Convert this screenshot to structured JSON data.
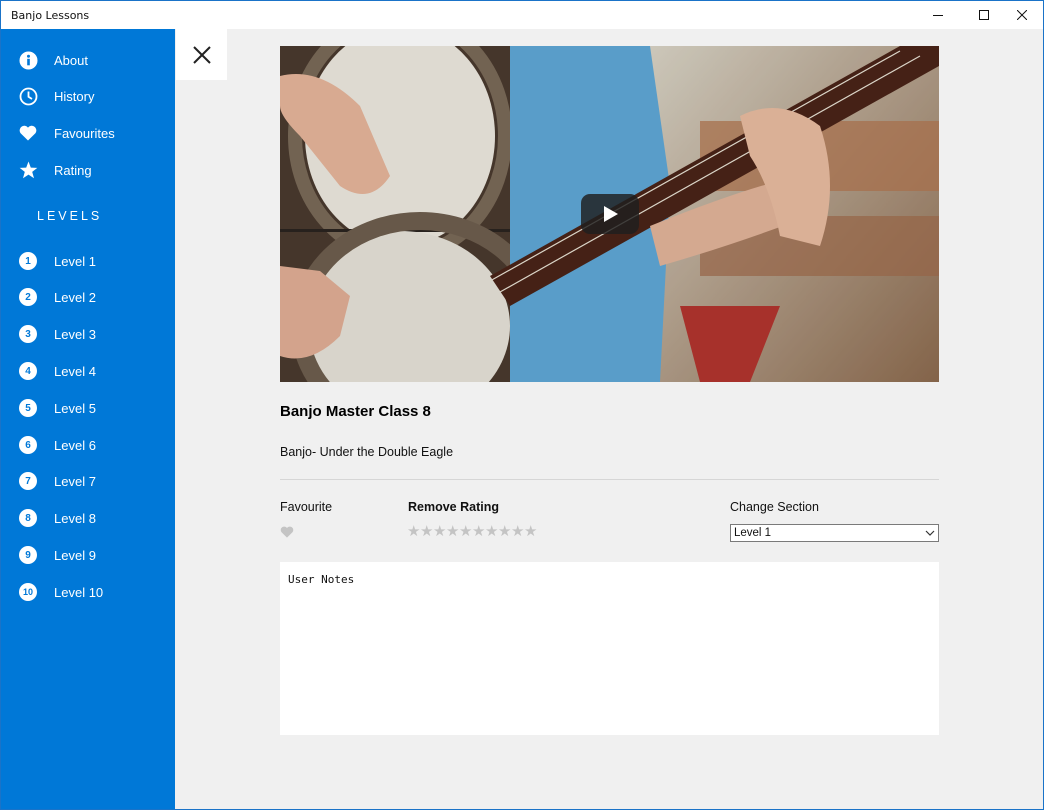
{
  "window": {
    "title": "Banjo Lessons"
  },
  "sidebar": {
    "menu": [
      {
        "label": "About",
        "icon": "info-icon"
      },
      {
        "label": "History",
        "icon": "clock-icon"
      },
      {
        "label": "Favourites",
        "icon": "heart-icon"
      },
      {
        "label": "Rating",
        "icon": "star-icon"
      }
    ],
    "levels_header": "LEVELS",
    "levels": [
      {
        "num": "1",
        "label": "Level 1"
      },
      {
        "num": "2",
        "label": "Level 2"
      },
      {
        "num": "3",
        "label": "Level 3"
      },
      {
        "num": "4",
        "label": "Level 4"
      },
      {
        "num": "5",
        "label": "Level 5"
      },
      {
        "num": "6",
        "label": "Level 6"
      },
      {
        "num": "7",
        "label": "Level 7"
      },
      {
        "num": "8",
        "label": "Level 8"
      },
      {
        "num": "9",
        "label": "Level 9"
      },
      {
        "num": "10",
        "label": "Level 10"
      }
    ]
  },
  "lesson": {
    "title": "Banjo Master Class 8",
    "subtitle": "Banjo- Under the Double Eagle"
  },
  "controls": {
    "favourite_label": "Favourite",
    "rating_label": "Remove Rating",
    "rating_value": 0,
    "rating_max": 10,
    "section_label": "Change Section",
    "section_selected": "Level 1"
  },
  "notes": {
    "text": "User Notes"
  },
  "colors": {
    "accent": "#0078d7",
    "background": "#f0f0f0",
    "star_empty": "#c4c4c4"
  }
}
